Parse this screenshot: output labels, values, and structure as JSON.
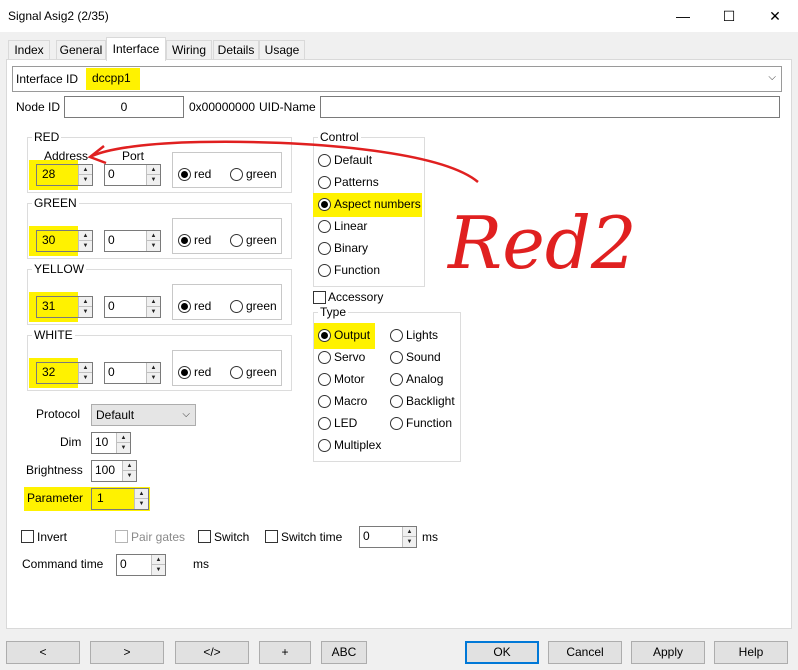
{
  "window": {
    "title": "Signal Asig2 (2/35)",
    "minimize": "—",
    "maximize": "☐",
    "close": "✕"
  },
  "tabs": [
    {
      "label": "Index"
    },
    {
      "label": "General"
    },
    {
      "label": "Interface"
    },
    {
      "label": "Wiring"
    },
    {
      "label": "Details"
    },
    {
      "label": "Usage"
    }
  ],
  "interface": {
    "label": "Interface ID",
    "value": "dccpp1"
  },
  "node": {
    "label": "Node ID",
    "value": "0",
    "hex": "0x00000000",
    "uid_label": "UID-Name",
    "uid_value": ""
  },
  "colors": {
    "address_label": "Address",
    "port_label": "Port",
    "red_option": "red",
    "green_option": "green",
    "groups": [
      {
        "name": "RED",
        "address": "28",
        "port": "0",
        "selected": "red"
      },
      {
        "name": "GREEN",
        "address": "30",
        "port": "0",
        "selected": "red"
      },
      {
        "name": "YELLOW",
        "address": "31",
        "port": "0",
        "selected": "red"
      },
      {
        "name": "WHITE",
        "address": "32",
        "port": "0",
        "selected": "red"
      }
    ]
  },
  "control": {
    "label": "Control",
    "options": [
      "Default",
      "Patterns",
      "Aspect numbers",
      "Linear",
      "Binary",
      "Function"
    ],
    "selected": "Aspect numbers"
  },
  "accessory": {
    "label": "Accessory",
    "checked": false
  },
  "type": {
    "label": "Type",
    "left_options": [
      "Output",
      "Servo",
      "Motor",
      "Macro",
      "LED",
      "Multiplex"
    ],
    "right_options": [
      "Lights",
      "Sound",
      "Analog",
      "Backlight",
      "Function"
    ],
    "selected": "Output"
  },
  "settings": {
    "protocol_label": "Protocol",
    "protocol_value": "Default",
    "dim_label": "Dim",
    "dim_value": "10",
    "brightness_label": "Brightness",
    "brightness_value": "100",
    "parameter_label": "Parameter",
    "parameter_value": "1"
  },
  "options": {
    "invert_label": "Invert",
    "pair_gates_label": "Pair gates",
    "switch_label": "Switch",
    "switch_time_label": "Switch time",
    "switch_time_value": "0",
    "ms": "ms",
    "command_time_label": "Command time",
    "command_time_value": "0"
  },
  "annotation": {
    "handwriting": "Red2",
    "color": "#e02020"
  },
  "bottom_buttons": {
    "prev": "<",
    "next": ">",
    "code": "</>",
    "add": "+",
    "abc": "ABC",
    "ok": "OK",
    "cancel": "Cancel",
    "apply": "Apply",
    "help": "Help"
  },
  "accent": "#0078d7",
  "highlight": "#fff200"
}
